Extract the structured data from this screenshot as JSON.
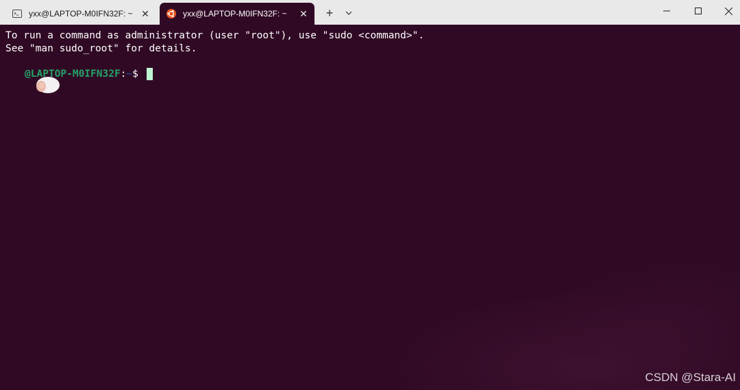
{
  "tabs": [
    {
      "title": "yxx@LAPTOP-M0IFN32F: ~",
      "icon": "console-icon",
      "active": false,
      "close_label": "✕"
    },
    {
      "title": "yxx@LAPTOP-M0IFN32F: ~",
      "icon": "ubuntu-icon",
      "active": true,
      "close_label": "✕"
    }
  ],
  "toolbar": {
    "new_tab_label": "+",
    "dropdown_icon": "chevron-down-icon"
  },
  "window_controls": {
    "minimize_icon": "minimize-icon",
    "maximize_icon": "maximize-icon",
    "close_icon": "close-icon"
  },
  "terminal": {
    "lines": [
      "To run a command as administrator (user \"root\"), use \"sudo <command>\".",
      "See \"man sudo_root\" for details."
    ],
    "prompt": {
      "host": "@LAPTOP-M0IFN32F",
      "separator": ":",
      "path": "~",
      "symbol": "$"
    }
  },
  "watermark": "CSDN @Stara-AI",
  "colors": {
    "terminal_bg": "#300a24",
    "titlebar_bg": "#e9e9e9",
    "prompt_host": "#26a269",
    "prompt_path": "#12488b",
    "cursor": "#bff4d2",
    "ubuntu_orange": "#e95420"
  }
}
